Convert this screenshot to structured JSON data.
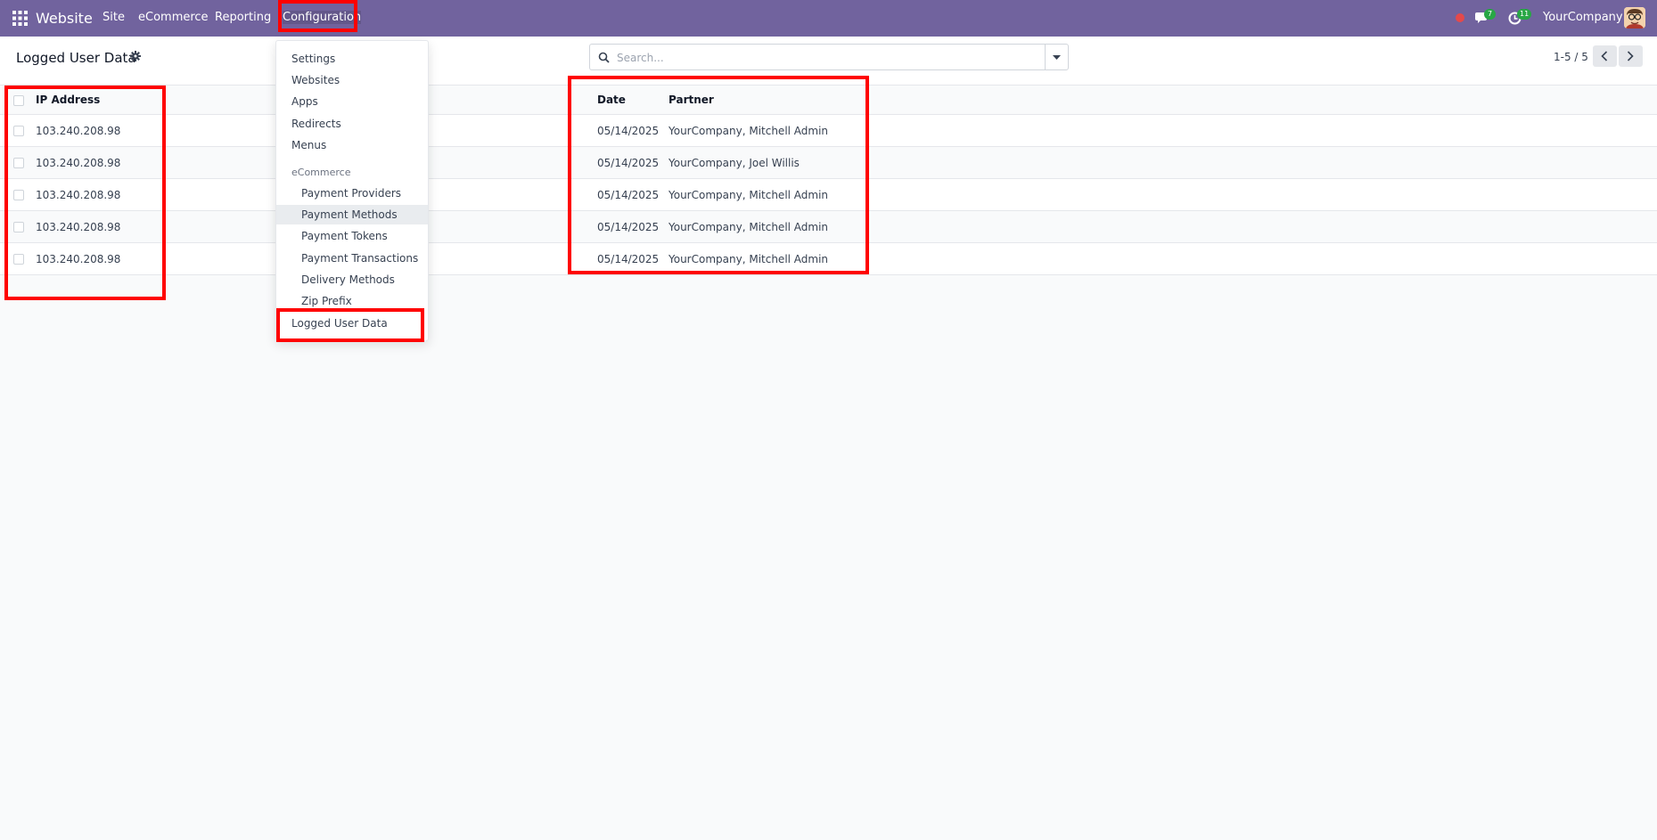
{
  "navbar": {
    "brand": "Website",
    "menu": [
      "Site",
      "eCommerce",
      "Reporting",
      "Configuration"
    ],
    "messages_count": "7",
    "activities_count": "11",
    "company": "YourCompany"
  },
  "control_panel": {
    "title": "Logged User Data",
    "search_placeholder": "Search...",
    "pager": "1-5 / 5"
  },
  "list": {
    "columns": {
      "ip": "IP Address",
      "date": "Date",
      "partner": "Partner"
    },
    "rows": [
      {
        "ip": "103.240.208.98",
        "date": "05/14/2025",
        "partner": "YourCompany, Mitchell Admin"
      },
      {
        "ip": "103.240.208.98",
        "date": "05/14/2025",
        "partner": "YourCompany, Joel Willis"
      },
      {
        "ip": "103.240.208.98",
        "date": "05/14/2025",
        "partner": "YourCompany, Mitchell Admin"
      },
      {
        "ip": "103.240.208.98",
        "date": "05/14/2025",
        "partner": "YourCompany, Mitchell Admin"
      },
      {
        "ip": "103.240.208.98",
        "date": "05/14/2025",
        "partner": "YourCompany, Mitchell Admin"
      }
    ]
  },
  "config_menu": {
    "items": [
      "Settings",
      "Websites",
      "Apps",
      "Redirects",
      "Menus"
    ],
    "section": "eCommerce",
    "ecommerce_items": [
      "Payment Providers",
      "Payment Methods",
      "Payment Tokens",
      "Payment Transactions",
      "Delivery Methods",
      "Zip Prefix"
    ],
    "last_item": "Logged User Data"
  },
  "colors": {
    "navbar": "#71639e",
    "highlight": "#ff0000",
    "badge": "#28a745"
  }
}
